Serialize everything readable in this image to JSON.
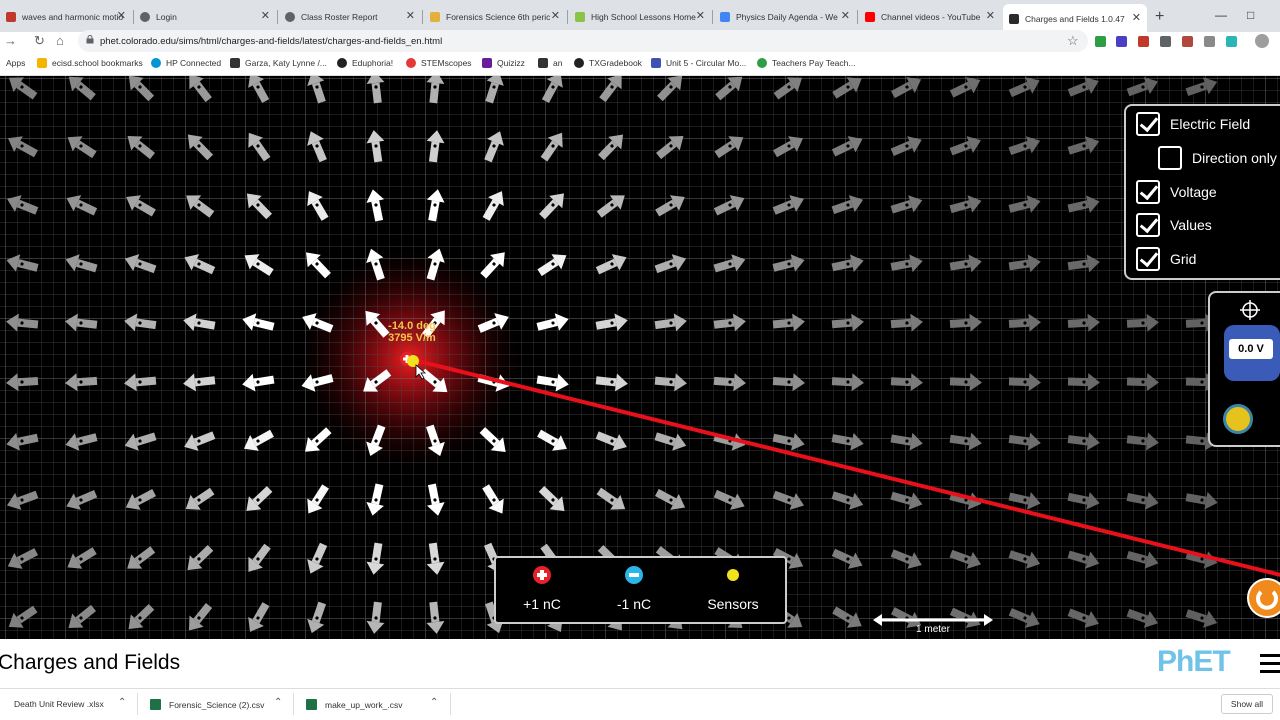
{
  "browser": {
    "tabs": [
      {
        "title": "waves and harmonic motio",
        "favicon_color": "#c0392b"
      },
      {
        "title": "Login",
        "favicon_color": "#5f6368"
      },
      {
        "title": "Class Roster Report",
        "favicon_color": "#5f6368"
      },
      {
        "title": "Forensics Science 6th peric",
        "favicon_color": "#e2b13c"
      },
      {
        "title": "High School Lessons Home",
        "favicon_color": "#8bc34a"
      },
      {
        "title": "Physics Daily Agenda - We",
        "favicon_color": "#4285f4"
      },
      {
        "title": "Channel videos - YouTube",
        "favicon_color": "#ff0000"
      },
      {
        "title": "Charges and Fields 1.0.47",
        "favicon_color": "#2b2b2b"
      }
    ],
    "tab_close_glyph": "✕",
    "new_tab_glyph": "+",
    "url": "phet.colorado.edu/sims/html/charges-and-fields/latest/charges-and-fields_en.html",
    "bookmarks": [
      {
        "label": "Apps",
        "color": "#4285f4"
      },
      {
        "label": "ecisd.school bookmarks",
        "color": "#f4b400"
      },
      {
        "label": "HP Connected",
        "color": "#0096d6"
      },
      {
        "label": "Garza, Katy Lynne /...",
        "color": "#333333"
      },
      {
        "label": "Eduphoria!",
        "color": "#222222"
      },
      {
        "label": "STEMscopes",
        "color": "#e53935"
      },
      {
        "label": "Quizizz",
        "color": "#6a1b9a"
      },
      {
        "label": "an",
        "color": "#333333"
      },
      {
        "label": "TXGradebook",
        "color": "#222222"
      },
      {
        "label": "Unit 5 - Circular Mo...",
        "color": "#3f51b5"
      },
      {
        "label": "Teachers Pay Teach...",
        "color": "#2e9e44"
      }
    ]
  },
  "sim": {
    "title": "Charges and Fields",
    "brand": "PhET",
    "readout": {
      "angle": "-14.0 deg",
      "magnitude": "3795 V/m"
    },
    "controls": [
      {
        "label": "Electric Field",
        "checked": true
      },
      {
        "label": "Direction only",
        "checked": false
      },
      {
        "label": "Voltage",
        "checked": true
      },
      {
        "label": "Values",
        "checked": true
      },
      {
        "label": "Grid",
        "checked": true
      }
    ],
    "voltmeter_value": "0.0 V",
    "charges": [
      {
        "label": "+1 nC",
        "kind": "positive"
      },
      {
        "label": "-1 nC",
        "kind": "negative"
      },
      {
        "label": "Sensors",
        "kind": "sensor"
      }
    ],
    "scale_label": "1 meter",
    "colors": {
      "positive": "#e8202a",
      "negative": "#2bb6e8",
      "sensor": "#f2e21e",
      "glow": "#c8101a"
    }
  },
  "downloads": [
    {
      "name": "Death Unit Review .xlsx"
    },
    {
      "name": "Forensic_Science (2).csv"
    },
    {
      "name": "make_up_work_.csv"
    }
  ],
  "show_all": "Show all"
}
